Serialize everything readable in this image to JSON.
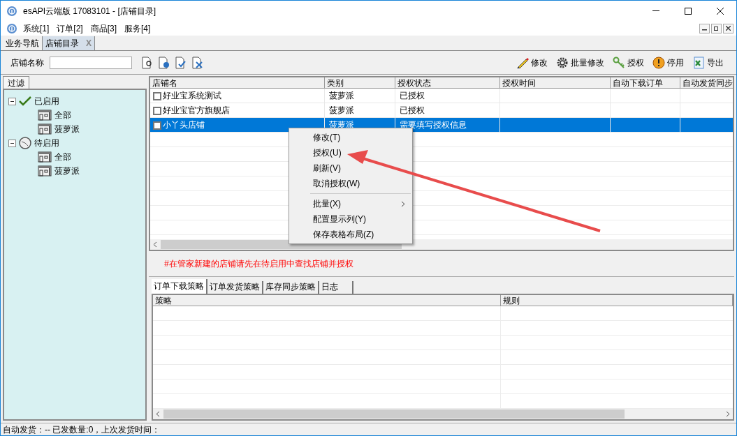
{
  "window": {
    "title": "esAPI云端版 17083101 - [店铺目录]"
  },
  "menu_bar": [
    "系统[1]",
    "订单[2]",
    "商品[3]",
    "服务[4]"
  ],
  "doc_tabs": [
    {
      "label": "业务导航",
      "selected": false
    },
    {
      "label": "店铺目录",
      "selected": true,
      "close": "X"
    }
  ],
  "toolbar": {
    "search_label": "店铺名称",
    "actions": [
      {
        "label": "修改",
        "kind": "pencil"
      },
      {
        "label": "批量修改",
        "kind": "gear"
      },
      {
        "label": "授权",
        "kind": "key"
      },
      {
        "label": "停用",
        "kind": "warning"
      },
      {
        "label": "导出",
        "kind": "sheet"
      }
    ]
  },
  "filter_panel": {
    "tab": "过滤",
    "tree": [
      {
        "label": "已启用",
        "kind": "check",
        "expanded": true,
        "children": [
          {
            "label": "全部"
          },
          {
            "label": "菠萝派"
          }
        ]
      },
      {
        "label": "待启用",
        "kind": "clock",
        "expanded": true,
        "children": [
          {
            "label": "全部"
          },
          {
            "label": "菠萝派"
          }
        ]
      }
    ]
  },
  "shop_table": {
    "columns": [
      "店铺名",
      "类别",
      "授权状态",
      "授权时间",
      "自动下载订单",
      "自动发货同步"
    ],
    "rows": [
      {
        "checked": false,
        "selected": false,
        "cells": [
          "好业宝系统测试",
          "菠萝派",
          "已授权"
        ]
      },
      {
        "checked": false,
        "selected": false,
        "cells": [
          "好业宝官方旗舰店",
          "菠萝派",
          "已授权"
        ]
      },
      {
        "checked": false,
        "selected": true,
        "cells": [
          "小丫头店铺",
          "菠萝派",
          "需要填写授权信息"
        ]
      }
    ]
  },
  "context_menu": {
    "items": [
      {
        "kind": "item",
        "label": "修改(T)"
      },
      {
        "kind": "item",
        "label": "授权(U)"
      },
      {
        "kind": "item",
        "label": "刷新(V)"
      },
      {
        "kind": "item",
        "label": "取消授权(W)"
      },
      {
        "kind": "separator"
      },
      {
        "kind": "submenu",
        "label": "批量(X)"
      },
      {
        "kind": "item",
        "label": "配置显示列(Y)"
      },
      {
        "kind": "item",
        "label": "保存表格布局(Z)"
      }
    ]
  },
  "notice": "#在管家新建的店铺请先在待启用中查找店铺并授权",
  "strategy_tabs": [
    {
      "label": "订单下载策略",
      "selected": true
    },
    {
      "label": "订单发货策略",
      "selected": false
    },
    {
      "label": "库存同步策略",
      "selected": false
    },
    {
      "label": "日志",
      "selected": false
    }
  ],
  "strategy_table": {
    "columns": [
      "策略",
      "规则"
    ]
  },
  "status_bar": "自动发货：-- 已发数量:0，上次发货时间："
}
